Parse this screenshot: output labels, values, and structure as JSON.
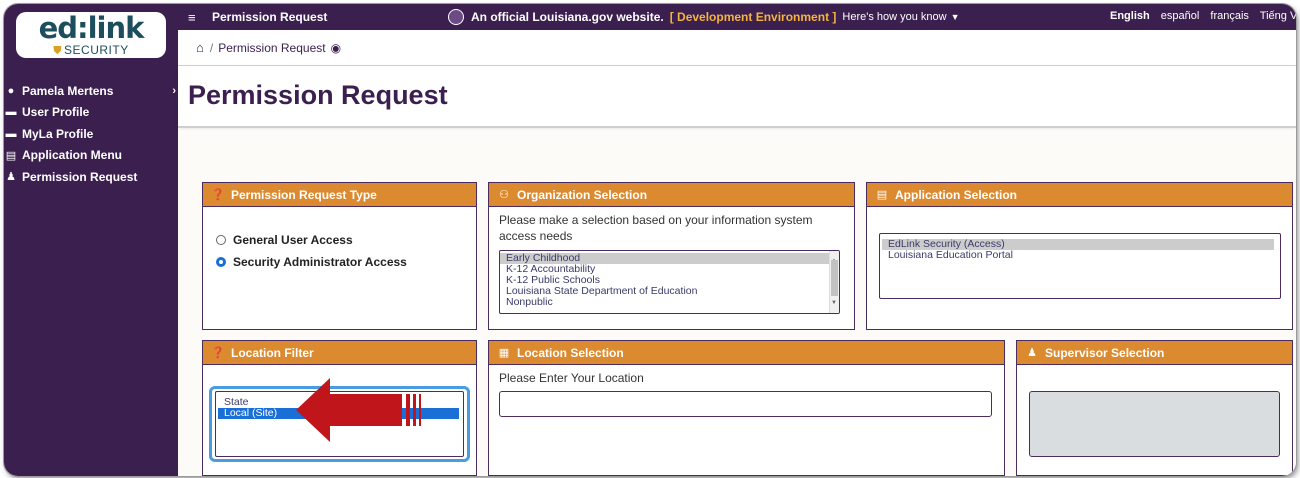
{
  "sidebar": {
    "logo_word": "ed:link",
    "logo_sub": "SECURITY",
    "items": [
      {
        "label": "Pamela Mertens",
        "icon": "user-circle-icon"
      },
      {
        "label": "User Profile",
        "icon": "id-card-icon"
      },
      {
        "label": "MyLa Profile",
        "icon": "id-card-icon"
      },
      {
        "label": "Application Menu",
        "icon": "window-icon"
      },
      {
        "label": "Permission Request",
        "icon": "user-key-icon"
      }
    ]
  },
  "topbar": {
    "title": "Permission Request",
    "official": "An official Louisiana.gov website.",
    "env": "[ Development Environment ]",
    "how": "Here's how you know",
    "languages": [
      "English",
      "español",
      "français",
      "Tiếng Việt"
    ]
  },
  "breadcrumb": {
    "current": "Permission Request"
  },
  "page_title": "Permission Request",
  "panels": {
    "request_type": {
      "title": "Permission Request Type",
      "options": [
        "General User Access",
        "Security Administrator Access"
      ],
      "selected": "Security Administrator Access"
    },
    "organization": {
      "title": "Organization Selection",
      "instruction": "Please make a selection based on your information system access needs",
      "options": [
        "Early Childhood",
        "K-12 Accountability",
        "K-12 Public Schools",
        "Louisiana State Department of Education",
        "Nonpublic"
      ],
      "selected": "Early Childhood"
    },
    "application": {
      "title": "Application Selection",
      "options": [
        "EdLink Security (Access)",
        "Louisiana Education Portal"
      ],
      "selected": "EdLink Security (Access)"
    },
    "location_filter": {
      "title": "Location Filter",
      "options": [
        "State",
        "Local (Site)"
      ],
      "selected": "Local (Site)"
    },
    "location_selection": {
      "title": "Location Selection",
      "instruction": "Please Enter Your Location",
      "value": ""
    },
    "supervisor": {
      "title": "Supervisor Selection"
    }
  },
  "colors": {
    "brand_purple": "#3b1f4f",
    "panel_header": "#dc8a2f",
    "accent_blue": "#1a6fd6",
    "env_gold": "#f3b53b",
    "annotation_arrow": "#c0151b"
  }
}
